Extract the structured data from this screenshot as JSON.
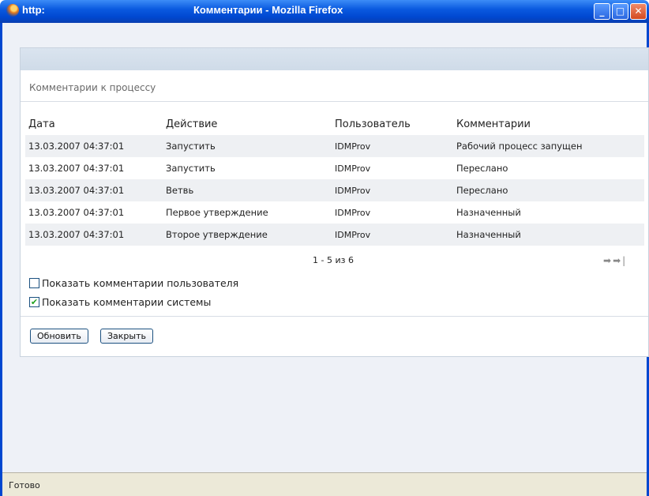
{
  "window": {
    "url_label": "http:",
    "title": "Комментарии - Mozilla Firefox",
    "minimize": "_",
    "maximize": "□",
    "close": "✕"
  },
  "panel": {
    "section_title": "Комментарии к процессу"
  },
  "table": {
    "headers": [
      "Дата",
      "Действие",
      "Пользователь",
      "Комментарии"
    ],
    "rows": [
      [
        "13.03.2007 04:37:01",
        "Запустить",
        "IDMProv",
        "Рабочий процесс запущен"
      ],
      [
        "13.03.2007 04:37:01",
        "Запустить",
        "IDMProv",
        "Переслано"
      ],
      [
        "13.03.2007 04:37:01",
        "Ветвь",
        "IDMProv",
        "Переслано"
      ],
      [
        "13.03.2007 04:37:01",
        "Первое утверждение",
        "IDMProv",
        "Назначенный"
      ],
      [
        "13.03.2007 04:37:01",
        "Второе утверждение",
        "IDMProv",
        "Назначенный"
      ]
    ]
  },
  "pager": {
    "text": "1 - 5 из 6",
    "next_icon": "arrow-right-icon",
    "last_icon": "arrow-last-icon"
  },
  "checkboxes": {
    "user_label": "Показать комментарии пользователя",
    "user_checked": false,
    "system_label": "Показать комментарии системы",
    "system_checked": true
  },
  "buttons": {
    "refresh": "Обновить",
    "close": "Закрыть"
  },
  "statusbar": {
    "text": "Готово"
  }
}
